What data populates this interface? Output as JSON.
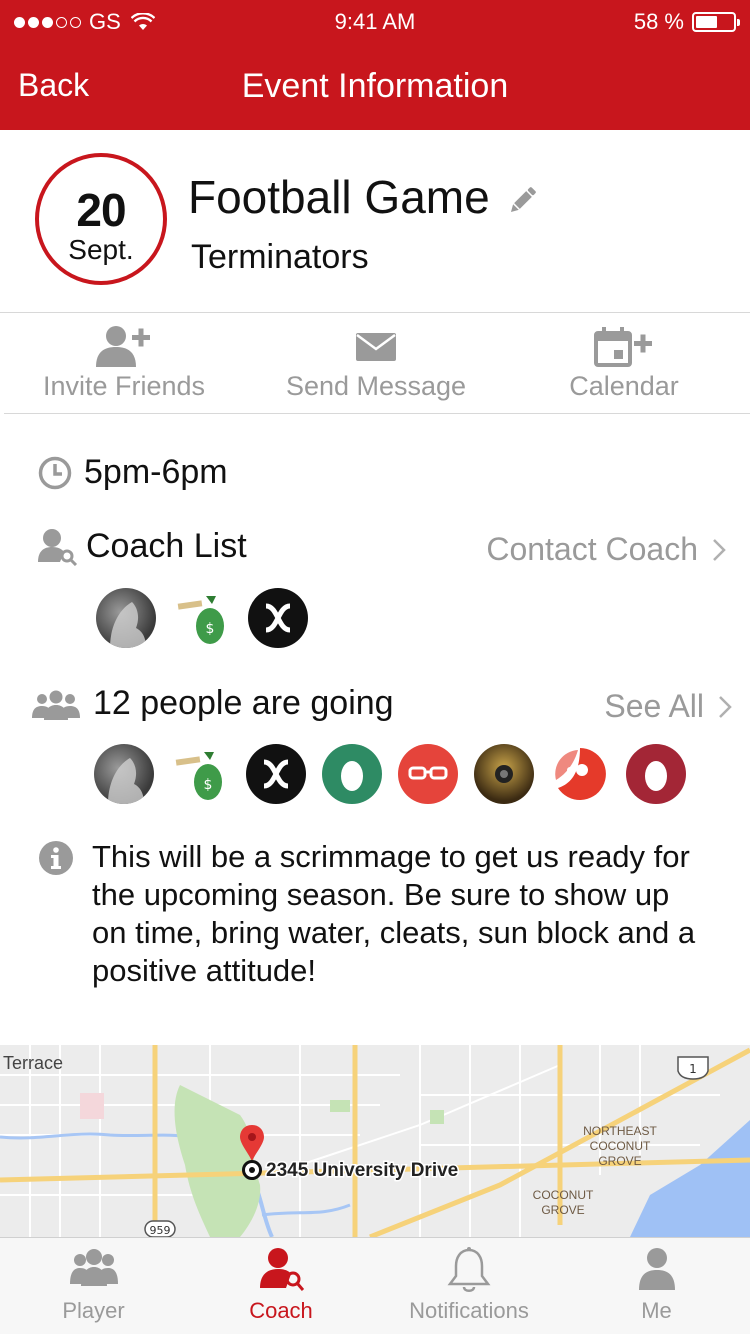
{
  "status_bar": {
    "carrier": "GS",
    "time": "9:41 AM",
    "battery": "58 %"
  },
  "nav": {
    "back_label": "Back",
    "title": "Event Information"
  },
  "event": {
    "day": "20",
    "month": "Sept.",
    "title": "Football Game",
    "team": "Terminators"
  },
  "actions": [
    {
      "label": "Invite Friends",
      "icon": "user-plus-icon"
    },
    {
      "label": "Send Message",
      "icon": "envelope-icon"
    },
    {
      "label": "Calendar",
      "icon": "calendar-plus-icon"
    }
  ],
  "time_range": "5pm-6pm",
  "coach": {
    "heading": "Coach List",
    "contact_label": "Contact Coach"
  },
  "attendees": {
    "heading": "12 people are going",
    "see_all_label": "See All"
  },
  "description": "This will be a scrimmage to get us ready for the upcoming season. Be sure to show up on time, bring water, cleats, sun block and a positive attitude!",
  "map": {
    "address": "2345 University Drive",
    "labels": {
      "terrace": "Terrace",
      "northeast_1": "NORTHEAST",
      "northeast_2": "COCONUT",
      "northeast_3": "GROVE",
      "coconut_1": "COCONUT",
      "coconut_2": "GROVE",
      "route_1": "1",
      "route_959": "959"
    }
  },
  "tabs": [
    {
      "label": "Player",
      "active": false
    },
    {
      "label": "Coach",
      "active": true
    },
    {
      "label": "Notifications",
      "active": false
    },
    {
      "label": "Me",
      "active": false
    }
  ],
  "colors": {
    "brand": "#c8161d",
    "muted": "#9a9a9a"
  }
}
